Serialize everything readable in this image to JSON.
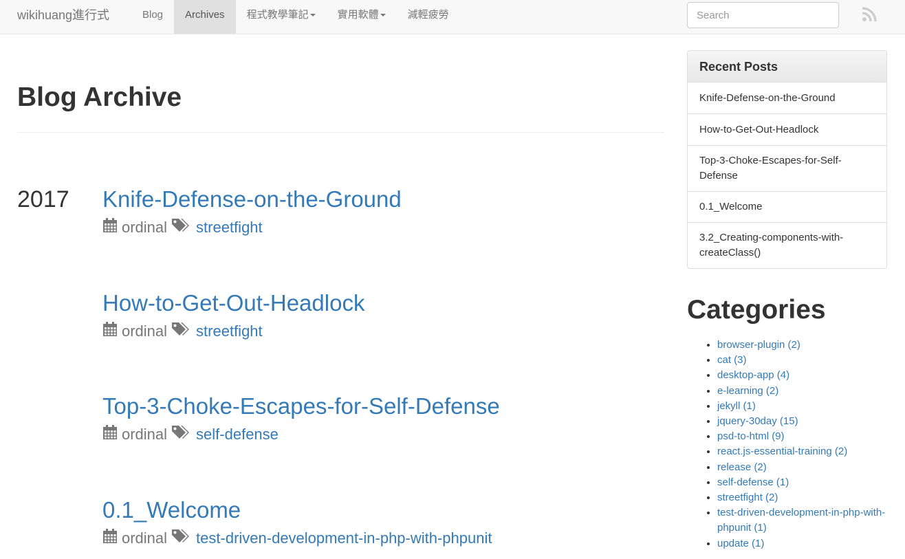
{
  "navbar": {
    "brand": "wikihuang進行式",
    "items": [
      {
        "label": "Blog",
        "active": false,
        "dropdown": false
      },
      {
        "label": "Archives",
        "active": true,
        "dropdown": false
      },
      {
        "label": "程式教學筆記",
        "active": false,
        "dropdown": true
      },
      {
        "label": "實用軟體",
        "active": false,
        "dropdown": true
      },
      {
        "label": "減輕疲勞",
        "active": false,
        "dropdown": false
      }
    ],
    "search_placeholder": "Search",
    "rss_icon": "rss-icon"
  },
  "main": {
    "title": "Blog Archive",
    "year": "2017",
    "posts": [
      {
        "title": "Knife-Defense-on-the-Ground",
        "meta": "ordinal",
        "tag": "streetfight"
      },
      {
        "title": "How-to-Get-Out-Headlock",
        "meta": "ordinal",
        "tag": "streetfight"
      },
      {
        "title": "Top-3-Choke-Escapes-for-Self-Defense",
        "meta": "ordinal",
        "tag": "self-defense"
      },
      {
        "title": "0.1_Welcome",
        "meta": "ordinal",
        "tag": "test-driven-development-in-php-with-phpunit"
      }
    ]
  },
  "sidebar": {
    "recent_title": "Recent Posts",
    "recent": [
      "Knife-Defense-on-the-Ground",
      "How-to-Get-Out-Headlock",
      "Top-3-Choke-Escapes-for-Self-Defense",
      "0.1_Welcome",
      "3.2_Creating-components-with-createClass()"
    ],
    "categories_title": "Categories",
    "categories": [
      "browser-plugin (2)",
      "cat (3)",
      "desktop-app (4)",
      "e-learning (2)",
      "jekyll (1)",
      "jquery-30day (15)",
      "psd-to-html (9)",
      "react.js-essential-training (2)",
      "release (2)",
      "self-defense (1)",
      "streetfight (2)",
      "test-driven-development-in-php-with-phpunit (1)",
      "update (1)"
    ]
  },
  "colors": {
    "link": "#337ab7",
    "navbar_bg": "#f8f8f8",
    "nav_active_bg": "#e0e0e0",
    "meta_text": "#777777"
  }
}
